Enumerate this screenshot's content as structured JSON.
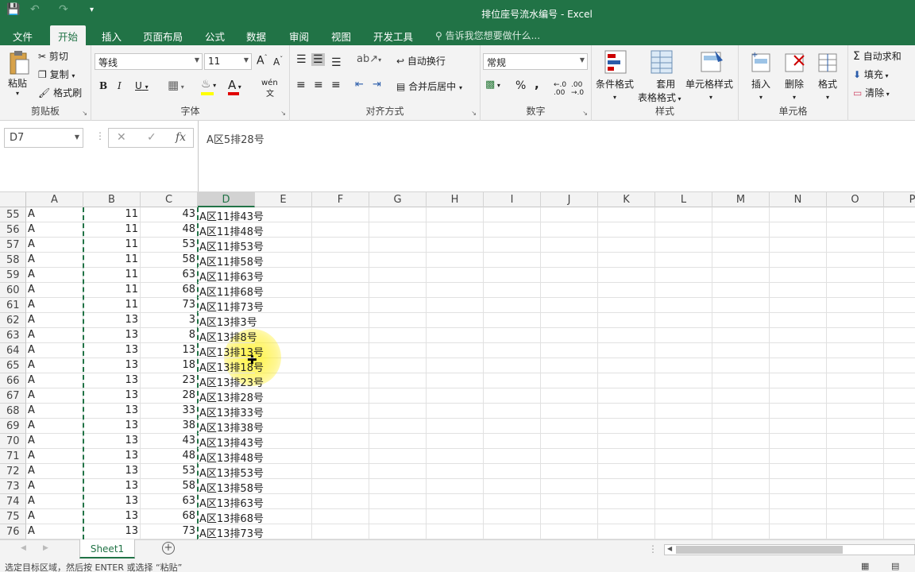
{
  "title": "排位座号流水编号 - Excel",
  "tabs": [
    "文件",
    "开始",
    "插入",
    "页面布局",
    "公式",
    "数据",
    "审阅",
    "视图",
    "开发工具"
  ],
  "active_tab": "开始",
  "tellme": "告诉我您想要做什么...",
  "ribbon": {
    "clipboard": {
      "paste": "粘贴",
      "cut": "剪切",
      "copy": "复制",
      "format_painter": "格式刷",
      "label": "剪贴板"
    },
    "font": {
      "name": "等线",
      "size": "11",
      "bold": "B",
      "italic": "I",
      "underline": "U",
      "phonetic": "wén",
      "label": "字体"
    },
    "align": {
      "wrap": "自动换行",
      "merge": "合并后居中",
      "label": "对齐方式"
    },
    "number": {
      "format": "常规",
      "percent": "%",
      "comma": ",",
      "label": "数字"
    },
    "styles": {
      "cond": "条件格式",
      "table": "套用",
      "table2": "表格格式",
      "cell": "单元格样式",
      "label": "样式"
    },
    "cells": {
      "insert": "插入",
      "delete": "删除",
      "format": "格式",
      "label": "单元格"
    },
    "editing": {
      "autosum": "自动求和",
      "fill": "填充",
      "clear": "清除"
    }
  },
  "namebox": "D7",
  "formula": "A区5排28号",
  "columns": [
    "A",
    "B",
    "C",
    "D",
    "E",
    "F",
    "G",
    "H",
    "I",
    "J",
    "K",
    "L",
    "M",
    "N",
    "O",
    "P"
  ],
  "selected_column": "D",
  "rows": [
    {
      "n": "55",
      "a": "A",
      "b": "11",
      "c": "43",
      "d": "A区11排43号"
    },
    {
      "n": "56",
      "a": "A",
      "b": "11",
      "c": "48",
      "d": "A区11排48号"
    },
    {
      "n": "57",
      "a": "A",
      "b": "11",
      "c": "53",
      "d": "A区11排53号"
    },
    {
      "n": "58",
      "a": "A",
      "b": "11",
      "c": "58",
      "d": "A区11排58号"
    },
    {
      "n": "59",
      "a": "A",
      "b": "11",
      "c": "63",
      "d": "A区11排63号"
    },
    {
      "n": "60",
      "a": "A",
      "b": "11",
      "c": "68",
      "d": "A区11排68号"
    },
    {
      "n": "61",
      "a": "A",
      "b": "11",
      "c": "73",
      "d": "A区11排73号"
    },
    {
      "n": "62",
      "a": "A",
      "b": "13",
      "c": "3",
      "d": "A区13排3号"
    },
    {
      "n": "63",
      "a": "A",
      "b": "13",
      "c": "8",
      "d": "A区13排8号"
    },
    {
      "n": "64",
      "a": "A",
      "b": "13",
      "c": "13",
      "d": "A区13排13号"
    },
    {
      "n": "65",
      "a": "A",
      "b": "13",
      "c": "18",
      "d": "A区13排18号"
    },
    {
      "n": "66",
      "a": "A",
      "b": "13",
      "c": "23",
      "d": "A区13排23号"
    },
    {
      "n": "67",
      "a": "A",
      "b": "13",
      "c": "28",
      "d": "A区13排28号"
    },
    {
      "n": "68",
      "a": "A",
      "b": "13",
      "c": "33",
      "d": "A区13排33号"
    },
    {
      "n": "69",
      "a": "A",
      "b": "13",
      "c": "38",
      "d": "A区13排38号"
    },
    {
      "n": "70",
      "a": "A",
      "b": "13",
      "c": "43",
      "d": "A区13排43号"
    },
    {
      "n": "71",
      "a": "A",
      "b": "13",
      "c": "48",
      "d": "A区13排48号"
    },
    {
      "n": "72",
      "a": "A",
      "b": "13",
      "c": "53",
      "d": "A区13排53号"
    },
    {
      "n": "73",
      "a": "A",
      "b": "13",
      "c": "58",
      "d": "A区13排58号"
    },
    {
      "n": "74",
      "a": "A",
      "b": "13",
      "c": "63",
      "d": "A区13排63号"
    },
    {
      "n": "75",
      "a": "A",
      "b": "13",
      "c": "68",
      "d": "A区13排68号"
    },
    {
      "n": "76",
      "a": "A",
      "b": "13",
      "c": "73",
      "d": "A区13排73号"
    }
  ],
  "sheet_tab": "Sheet1",
  "status": "选定目标区域，然后按 ENTER 或选择 “粘贴”",
  "colors": {
    "accent": "#217346",
    "highlight": "#ffff00"
  }
}
